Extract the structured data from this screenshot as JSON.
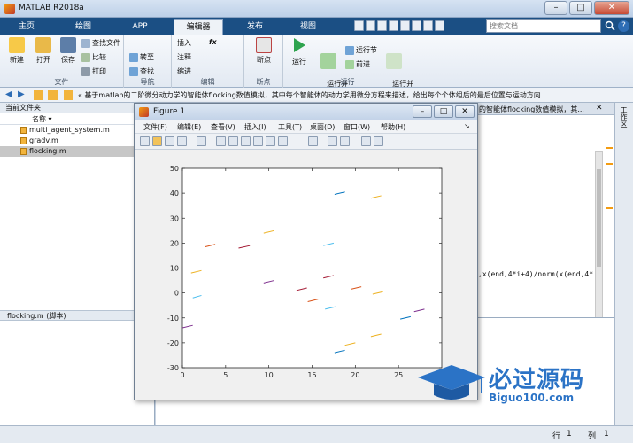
{
  "window": {
    "title": "MATLAB R2018a"
  },
  "tabs": [
    {
      "label": "主页"
    },
    {
      "label": "绘图"
    },
    {
      "label": "APP"
    },
    {
      "label": "编辑器"
    },
    {
      "label": "发布"
    },
    {
      "label": "视图"
    }
  ],
  "search": {
    "placeholder": "搜索文档"
  },
  "ribbon": {
    "file": {
      "label": "文件",
      "new": "新建",
      "open": "打开",
      "save": "保存",
      "find_files": "查找文件",
      "compare": "比较",
      "print": "打印"
    },
    "nav": {
      "label": "导航",
      "goto": "转至",
      "find": "查找"
    },
    "edit": {
      "label": "编辑",
      "insert": "插入",
      "comment": "注释",
      "indent": "缩进",
      "fx": "fx"
    },
    "breakpoints": {
      "label": "断点",
      "btn": "断点"
    },
    "run": {
      "label": "运行",
      "run": "运行",
      "run_advance": "运行并\n前进",
      "run_section": "运行节",
      "advance": "前进",
      "run_time": "运行并\n计时"
    }
  },
  "address": {
    "path": "基于matlab的二阶微分动力学的智能体flocking数值模拟，其中每个智能体的动力学用微分方程来描述，给出每个个体组后的最后位置与运动方向"
  },
  "left_panel": {
    "title": "当前文件夹",
    "column": "名称",
    "files": [
      {
        "name": "multi_agent_system.m"
      },
      {
        "name": "gradv.m"
      },
      {
        "name": "flocking.m"
      }
    ],
    "details": "flocking.m  (脚本)"
  },
  "editor": {
    "tab_text": "的智能体flocking数值模拟，其...",
    "code_line": ",x(end,4*i+4)/norm(x(end,4*"
  },
  "right_strip": {
    "label": "工作区"
  },
  "status": {
    "row_label": "行",
    "row": "1",
    "col_label": "列",
    "col": "1"
  },
  "figure": {
    "title": "Figure 1",
    "menus": [
      "文件(F)",
      "编辑(E)",
      "查看(V)",
      "插入(I)",
      "工具(T)",
      "桌面(D)",
      "窗口(W)",
      "帮助(H)"
    ]
  },
  "watermark": {
    "main": "必过源码",
    "sub": "Biguo100.com"
  },
  "chart_data": {
    "type": "line",
    "title": "",
    "xlabel": "",
    "ylabel": "",
    "xlim": [
      0,
      30
    ],
    "ylim": [
      -30,
      50
    ],
    "xticks": [
      0,
      5,
      10,
      15,
      20,
      25
    ],
    "yticks": [
      -30,
      -20,
      -10,
      0,
      10,
      20,
      30,
      40,
      50
    ],
    "grid": false,
    "segments": [
      {
        "x1": 0,
        "y1": -14,
        "x2": 1.2,
        "y2": -13,
        "color": "#7e2f8e"
      },
      {
        "x1": 1.2,
        "y1": -2,
        "x2": 2.2,
        "y2": -1,
        "color": "#4dbeee"
      },
      {
        "x1": 1.0,
        "y1": 8,
        "x2": 2.2,
        "y2": 9,
        "color": "#edb120"
      },
      {
        "x1": 2.6,
        "y1": 18.5,
        "x2": 3.8,
        "y2": 19.5,
        "color": "#d95319"
      },
      {
        "x1": 6.5,
        "y1": 18,
        "x2": 7.8,
        "y2": 19,
        "color": "#a2142f"
      },
      {
        "x1": 9.4,
        "y1": 24,
        "x2": 10.6,
        "y2": 25,
        "color": "#edb120"
      },
      {
        "x1": 9.4,
        "y1": 4,
        "x2": 10.6,
        "y2": 5,
        "color": "#7e2f8e"
      },
      {
        "x1": 13.2,
        "y1": 1,
        "x2": 14.4,
        "y2": 2,
        "color": "#a2142f"
      },
      {
        "x1": 14.5,
        "y1": -3.5,
        "x2": 15.7,
        "y2": -2.5,
        "color": "#d95319"
      },
      {
        "x1": 16.3,
        "y1": 6,
        "x2": 17.5,
        "y2": 7,
        "color": "#a2142f"
      },
      {
        "x1": 16.5,
        "y1": -6.5,
        "x2": 17.7,
        "y2": -5.5,
        "color": "#4dbeee"
      },
      {
        "x1": 16.3,
        "y1": 19,
        "x2": 17.5,
        "y2": 20,
        "color": "#4dbeee"
      },
      {
        "x1": 17.6,
        "y1": 39.5,
        "x2": 18.8,
        "y2": 40.5,
        "color": "#0072bd"
      },
      {
        "x1": 17.6,
        "y1": -24,
        "x2": 18.8,
        "y2": -23,
        "color": "#0072bd"
      },
      {
        "x1": 18.8,
        "y1": -21,
        "x2": 20.0,
        "y2": -20,
        "color": "#edb120"
      },
      {
        "x1": 19.5,
        "y1": 1.5,
        "x2": 20.7,
        "y2": 2.5,
        "color": "#d95319"
      },
      {
        "x1": 21.8,
        "y1": 38,
        "x2": 23.0,
        "y2": 39,
        "color": "#edb120"
      },
      {
        "x1": 22.0,
        "y1": -0.5,
        "x2": 23.2,
        "y2": 0.5,
        "color": "#edb120"
      },
      {
        "x1": 21.8,
        "y1": -17.5,
        "x2": 23.0,
        "y2": -16.5,
        "color": "#edb120"
      },
      {
        "x1": 25.2,
        "y1": -10.5,
        "x2": 26.4,
        "y2": -9.5,
        "color": "#0072bd"
      },
      {
        "x1": 26.8,
        "y1": -7.5,
        "x2": 28.0,
        "y2": -6.5,
        "color": "#7e2f8e"
      }
    ]
  }
}
